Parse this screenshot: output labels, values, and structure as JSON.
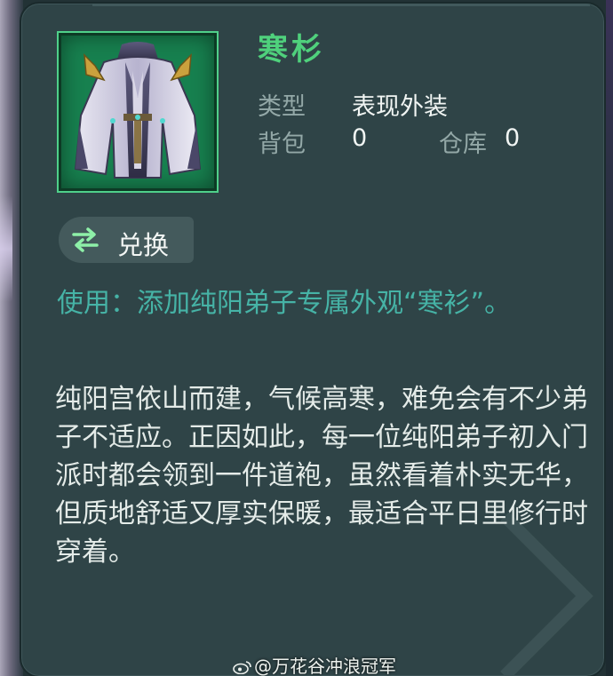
{
  "item": {
    "name": "寒杉",
    "type_label": "类型",
    "type_value": "表现外装",
    "bag_label": "背包",
    "bag_count": "0",
    "warehouse_label": "仓库",
    "warehouse_count": "0",
    "icon": "purple-white-robe-outfit-icon"
  },
  "actions": {
    "exchange_label": "兑换",
    "exchange_icon": "swap-arrows-icon"
  },
  "usage_text": "使用：添加纯阳弟子专属外观“寒衫”。",
  "description": "纯阳宫依山而建，气候高寒，难免会有不少弟子不适应。正因如此，每一位纯阳弟子初入门派时都会领到一件道袍，虽然看着朴实无华，但质地舒适又厚实保暖，最适合平日里修行时穿着。",
  "watermark": "@万花谷冲浪冠军",
  "colors": {
    "panel": "#2f4447",
    "item_name": "#4fd17c",
    "usage_text": "#46b3a6",
    "description_text": "#e4ebe8",
    "icon_bg": "#17804f"
  }
}
